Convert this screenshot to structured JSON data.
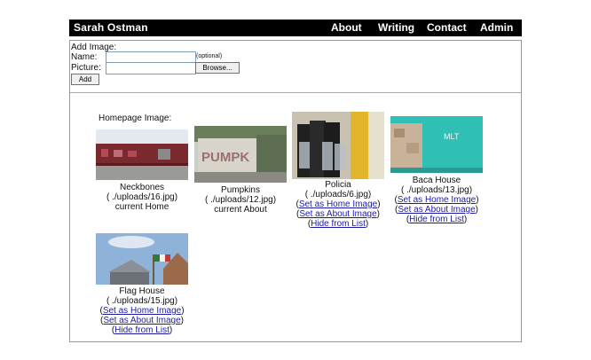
{
  "header": {
    "title": "Sarah Ostman",
    "nav": [
      "About",
      "Writing",
      "Contact",
      "Admin"
    ]
  },
  "add_form": {
    "title": "Add Image:",
    "name_label": "Name:",
    "name_value": "",
    "name_hint": "(optional)",
    "picture_label": "Picture:",
    "picture_value": "",
    "browse_label": "Browse...",
    "add_label": "Add"
  },
  "gallery": {
    "homepage_label": "Homepage Image:",
    "items": [
      {
        "name": "Neckbones",
        "path": "( ./uploads/16.jpg)",
        "status": "current Home"
      },
      {
        "name": "Pumpkins",
        "path": "( ./uploads/12.jpg)",
        "status": "current About"
      },
      {
        "name": "Policia",
        "path": "( ./uploads/6.jpg)",
        "set_home": "Set as Home Image",
        "set_about": "Set as About Image",
        "hide": "Hide from List"
      },
      {
        "name": "Baca House",
        "path": "( ./uploads/13.jpg)",
        "set_home": "Set as Home Image",
        "set_about": "Set as About Image",
        "hide": "Hide from List"
      },
      {
        "name": "Flag House",
        "path": "( ./uploads/15.jpg)",
        "set_home": "Set as Home Image",
        "set_about": "Set as About Image",
        "hide": "Hide from List"
      }
    ]
  }
}
